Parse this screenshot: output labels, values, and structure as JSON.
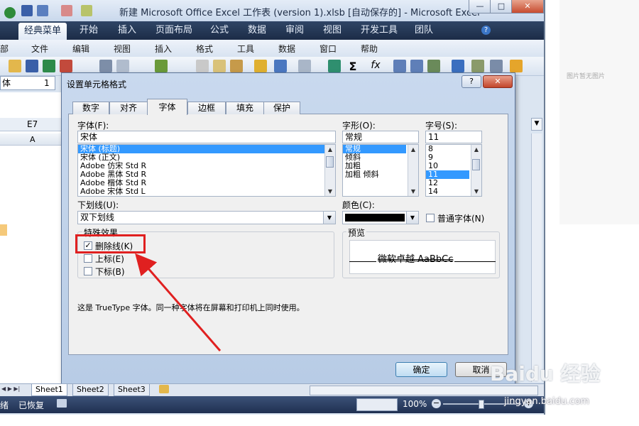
{
  "window": {
    "title": "新建 Microsoft Office Excel 工作表 (version 1).xlsb [自动保存的] - Microsoft Excel",
    "controls": {
      "minimize": "—",
      "restore": "□",
      "close": "✕"
    }
  },
  "ribbon_tabs": [
    "经典菜单",
    "开始",
    "插入",
    "页面布局",
    "公式",
    "数据",
    "审阅",
    "视图",
    "开发工具",
    "团队"
  ],
  "menu_items": [
    "部",
    "文件",
    "编辑",
    "视图",
    "插入",
    "格式",
    "工具",
    "数据",
    "窗口",
    "帮助"
  ],
  "toolbar": {
    "font_box": "体",
    "size_box": "1"
  },
  "sheet": {
    "cell_ref": "E7",
    "column_a": "A"
  },
  "dialog": {
    "title": "设置单元格格式",
    "help": "?",
    "close": "✕",
    "tabs": [
      "数字",
      "对齐",
      "字体",
      "边框",
      "填充",
      "保护"
    ],
    "active_tab": "字体",
    "font": {
      "label": "字体(F):",
      "value": "宋体",
      "options": [
        "宋体 (标题)",
        "宋体 (正文)",
        "Adobe 仿宋 Std R",
        "Adobe 黑体 Std R",
        "Adobe 楷体 Std R",
        "Adobe 宋体 Std L"
      ],
      "selected_index": 0
    },
    "style": {
      "label": "字形(O):",
      "value": "常规",
      "options": [
        "常规",
        "倾斜",
        "加粗",
        "加粗 倾斜"
      ],
      "selected_index": 0
    },
    "size": {
      "label": "字号(S):",
      "value": "11",
      "options": [
        "8",
        "9",
        "10",
        "11",
        "12",
        "14"
      ],
      "selected_index": 3
    },
    "underline": {
      "label": "下划线(U):",
      "value": "双下划线"
    },
    "color": {
      "label": "颜色(C):",
      "value_hex": "#000000"
    },
    "normal_font": {
      "label": "普通字体(N)",
      "checked": false
    },
    "effects": {
      "label": "特殊效果",
      "strikethrough": {
        "label": "删除线(K)",
        "checked": true
      },
      "superscript": {
        "label": "上标(E)",
        "checked": false
      },
      "subscript": {
        "label": "下标(B)",
        "checked": false
      }
    },
    "preview": {
      "label": "预览",
      "text": "微软卓越  AaBbCc"
    },
    "info": "这是 TrueType 字体。同一种字体将在屏幕和打印机上同时使用。",
    "ok": "确定",
    "cancel": "取消"
  },
  "sheet_tabs": [
    "Sheet1",
    "Sheet2",
    "Sheet3"
  ],
  "status": {
    "left": "绪",
    "recovered": "已恢复",
    "zoom": "100%"
  },
  "right_panel": {
    "text": "图片暂无图片"
  },
  "watermark": {
    "main": "Baidu 经验",
    "sub": "jingyan.baidu.com"
  },
  "colors": {
    "highlight": "#e02020",
    "arrow": "#e02020",
    "selection": "#3399ff"
  }
}
